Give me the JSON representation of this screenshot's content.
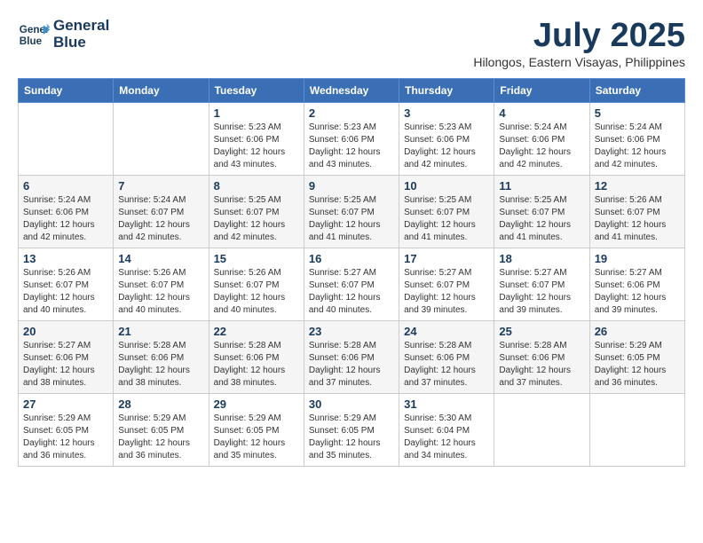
{
  "header": {
    "logo_line1": "General",
    "logo_line2": "Blue",
    "month_year": "July 2025",
    "location": "Hilongos, Eastern Visayas, Philippines"
  },
  "days_of_week": [
    "Sunday",
    "Monday",
    "Tuesday",
    "Wednesday",
    "Thursday",
    "Friday",
    "Saturday"
  ],
  "weeks": [
    [
      {
        "day": "",
        "info": ""
      },
      {
        "day": "",
        "info": ""
      },
      {
        "day": "1",
        "info": "Sunrise: 5:23 AM\nSunset: 6:06 PM\nDaylight: 12 hours and 43 minutes."
      },
      {
        "day": "2",
        "info": "Sunrise: 5:23 AM\nSunset: 6:06 PM\nDaylight: 12 hours and 43 minutes."
      },
      {
        "day": "3",
        "info": "Sunrise: 5:23 AM\nSunset: 6:06 PM\nDaylight: 12 hours and 42 minutes."
      },
      {
        "day": "4",
        "info": "Sunrise: 5:24 AM\nSunset: 6:06 PM\nDaylight: 12 hours and 42 minutes."
      },
      {
        "day": "5",
        "info": "Sunrise: 5:24 AM\nSunset: 6:06 PM\nDaylight: 12 hours and 42 minutes."
      }
    ],
    [
      {
        "day": "6",
        "info": "Sunrise: 5:24 AM\nSunset: 6:06 PM\nDaylight: 12 hours and 42 minutes."
      },
      {
        "day": "7",
        "info": "Sunrise: 5:24 AM\nSunset: 6:07 PM\nDaylight: 12 hours and 42 minutes."
      },
      {
        "day": "8",
        "info": "Sunrise: 5:25 AM\nSunset: 6:07 PM\nDaylight: 12 hours and 42 minutes."
      },
      {
        "day": "9",
        "info": "Sunrise: 5:25 AM\nSunset: 6:07 PM\nDaylight: 12 hours and 41 minutes."
      },
      {
        "day": "10",
        "info": "Sunrise: 5:25 AM\nSunset: 6:07 PM\nDaylight: 12 hours and 41 minutes."
      },
      {
        "day": "11",
        "info": "Sunrise: 5:25 AM\nSunset: 6:07 PM\nDaylight: 12 hours and 41 minutes."
      },
      {
        "day": "12",
        "info": "Sunrise: 5:26 AM\nSunset: 6:07 PM\nDaylight: 12 hours and 41 minutes."
      }
    ],
    [
      {
        "day": "13",
        "info": "Sunrise: 5:26 AM\nSunset: 6:07 PM\nDaylight: 12 hours and 40 minutes."
      },
      {
        "day": "14",
        "info": "Sunrise: 5:26 AM\nSunset: 6:07 PM\nDaylight: 12 hours and 40 minutes."
      },
      {
        "day": "15",
        "info": "Sunrise: 5:26 AM\nSunset: 6:07 PM\nDaylight: 12 hours and 40 minutes."
      },
      {
        "day": "16",
        "info": "Sunrise: 5:27 AM\nSunset: 6:07 PM\nDaylight: 12 hours and 40 minutes."
      },
      {
        "day": "17",
        "info": "Sunrise: 5:27 AM\nSunset: 6:07 PM\nDaylight: 12 hours and 39 minutes."
      },
      {
        "day": "18",
        "info": "Sunrise: 5:27 AM\nSunset: 6:07 PM\nDaylight: 12 hours and 39 minutes."
      },
      {
        "day": "19",
        "info": "Sunrise: 5:27 AM\nSunset: 6:06 PM\nDaylight: 12 hours and 39 minutes."
      }
    ],
    [
      {
        "day": "20",
        "info": "Sunrise: 5:27 AM\nSunset: 6:06 PM\nDaylight: 12 hours and 38 minutes."
      },
      {
        "day": "21",
        "info": "Sunrise: 5:28 AM\nSunset: 6:06 PM\nDaylight: 12 hours and 38 minutes."
      },
      {
        "day": "22",
        "info": "Sunrise: 5:28 AM\nSunset: 6:06 PM\nDaylight: 12 hours and 38 minutes."
      },
      {
        "day": "23",
        "info": "Sunrise: 5:28 AM\nSunset: 6:06 PM\nDaylight: 12 hours and 37 minutes."
      },
      {
        "day": "24",
        "info": "Sunrise: 5:28 AM\nSunset: 6:06 PM\nDaylight: 12 hours and 37 minutes."
      },
      {
        "day": "25",
        "info": "Sunrise: 5:28 AM\nSunset: 6:06 PM\nDaylight: 12 hours and 37 minutes."
      },
      {
        "day": "26",
        "info": "Sunrise: 5:29 AM\nSunset: 6:05 PM\nDaylight: 12 hours and 36 minutes."
      }
    ],
    [
      {
        "day": "27",
        "info": "Sunrise: 5:29 AM\nSunset: 6:05 PM\nDaylight: 12 hours and 36 minutes."
      },
      {
        "day": "28",
        "info": "Sunrise: 5:29 AM\nSunset: 6:05 PM\nDaylight: 12 hours and 36 minutes."
      },
      {
        "day": "29",
        "info": "Sunrise: 5:29 AM\nSunset: 6:05 PM\nDaylight: 12 hours and 35 minutes."
      },
      {
        "day": "30",
        "info": "Sunrise: 5:29 AM\nSunset: 6:05 PM\nDaylight: 12 hours and 35 minutes."
      },
      {
        "day": "31",
        "info": "Sunrise: 5:30 AM\nSunset: 6:04 PM\nDaylight: 12 hours and 34 minutes."
      },
      {
        "day": "",
        "info": ""
      },
      {
        "day": "",
        "info": ""
      }
    ]
  ]
}
